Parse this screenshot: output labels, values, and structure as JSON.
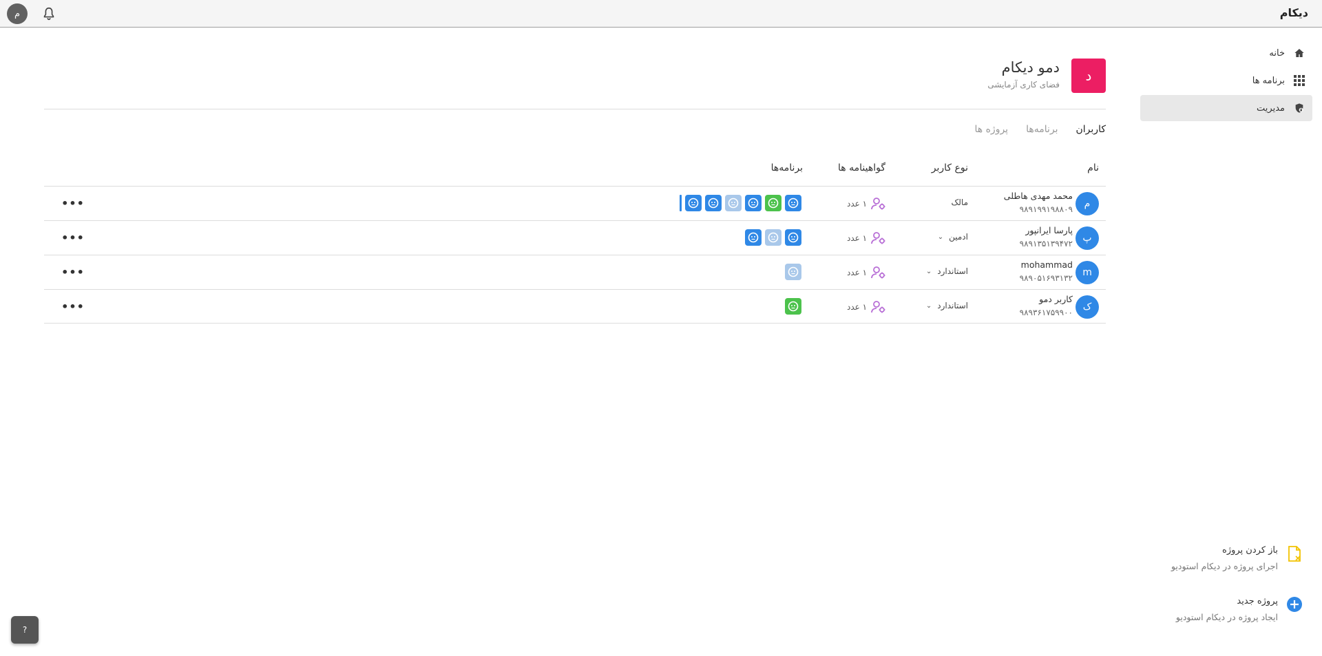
{
  "app": {
    "brand": "دیکام",
    "avatar_letter": "م"
  },
  "sidebar": {
    "items": [
      {
        "label": "خانه",
        "icon": "home-icon",
        "active": false
      },
      {
        "label": "برنامه ها",
        "icon": "apps-grid-icon",
        "active": false
      },
      {
        "label": "مدیریت",
        "icon": "shield-lock-icon",
        "active": true
      }
    ]
  },
  "workspace": {
    "logo_letter": "د",
    "title": "دمو دیکام",
    "subtitle": "فضای کاری آزمایشی",
    "logo_color": "#ec1e63"
  },
  "tabs": [
    {
      "label": "کاربران",
      "active": true
    },
    {
      "label": "برنامه‌ها",
      "active": false
    },
    {
      "label": "پروژه ها",
      "active": false
    }
  ],
  "table": {
    "headers": {
      "name": "نام",
      "type": "نوع کاربر",
      "certs": "گواهینامه ها",
      "apps": "برنامه‌ها"
    },
    "rows": [
      {
        "avatar": "م",
        "name": "محمد مهدی هاطلی",
        "phone": "۹۸۹۱۹۹۱۹۸۸۰۹",
        "type": "مالک",
        "has_dropdown": false,
        "certs": "۱ عدد",
        "apps": [
          "blue",
          "green",
          "blue",
          "light",
          "blue",
          "blue"
        ],
        "truncated": true
      },
      {
        "avatar": "پ",
        "name": "پارسا ایرانپور",
        "phone": "۹۸۹۱۳۵۱۳۹۴۷۲",
        "type": "ادمین",
        "has_dropdown": true,
        "certs": "۱ عدد",
        "apps": [
          "blue",
          "light",
          "blue"
        ],
        "truncated": false
      },
      {
        "avatar": "m",
        "name": "mohammad",
        "phone": "۹۸۹۰۵۱۶۹۳۱۳۲",
        "type": "استاندارد",
        "has_dropdown": true,
        "certs": "۱ عدد",
        "apps": [
          "light"
        ],
        "truncated": false
      },
      {
        "avatar": "ک",
        "name": "کاربر دمو",
        "phone": "۹۸۹۳۶۱۷۵۹۹۰۰",
        "type": "استاندارد",
        "has_dropdown": true,
        "certs": "۱ عدد",
        "apps": [
          "green"
        ],
        "truncated": false
      }
    ]
  },
  "actions": [
    {
      "title": "باز کردن پروژه",
      "subtitle": "اجرای پروژه در دیکام استودیو",
      "icon": "open-file-icon"
    },
    {
      "title": "پروژه جدید",
      "subtitle": "ایجاد پروژه در دیکام استودیو",
      "icon": "add-circle-icon"
    }
  ],
  "help": {
    "label": "?"
  },
  "colors": {
    "accent": "#2f88e6",
    "green": "#4cc24c",
    "light": "#a9c8ea",
    "cert_icon": "#b86fd6",
    "open_file": "#f2c200"
  }
}
